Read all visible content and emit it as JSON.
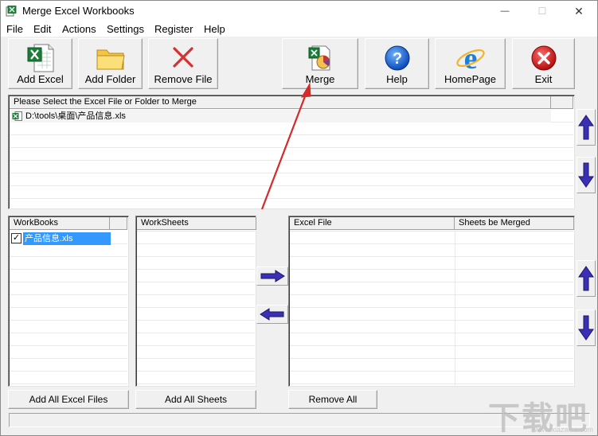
{
  "window": {
    "title": "Merge Excel Workbooks",
    "minimize_glyph": "—",
    "maximize_glyph": "☐",
    "close_glyph": "✕"
  },
  "menu": {
    "items": [
      "File",
      "Edit",
      "Actions",
      "Settings",
      "Register",
      "Help"
    ]
  },
  "toolbar": {
    "add_excel": "Add Excel",
    "add_folder": "Add Folder",
    "remove_file": "Remove File",
    "merge": "Merge",
    "help": "Help",
    "homepage": "HomePage",
    "exit": "Exit"
  },
  "file_list": {
    "header": "Please Select the Excel File or Folder to Merge",
    "items": [
      "D:\\tools\\桌面\\产品信息.xls"
    ]
  },
  "workbooks": {
    "header": "WorkBooks",
    "items": [
      {
        "name": "产品信息.xls",
        "checked": true
      }
    ]
  },
  "worksheets": {
    "header": "WorkSheets"
  },
  "merge_table": {
    "columns": [
      "Excel File",
      "Sheets be Merged"
    ]
  },
  "buttons": {
    "add_all_excel_files": "Add All Excel Files",
    "add_all_sheets": "Add All Sheets",
    "remove_all": "Remove All"
  },
  "watermark": {
    "text": "下载吧",
    "sub": "www.xiazaiba.com"
  },
  "colors": {
    "selection": "#3399ff",
    "arrow_blue": "#3a2fb5",
    "annotation_red": "#d42a2a"
  }
}
